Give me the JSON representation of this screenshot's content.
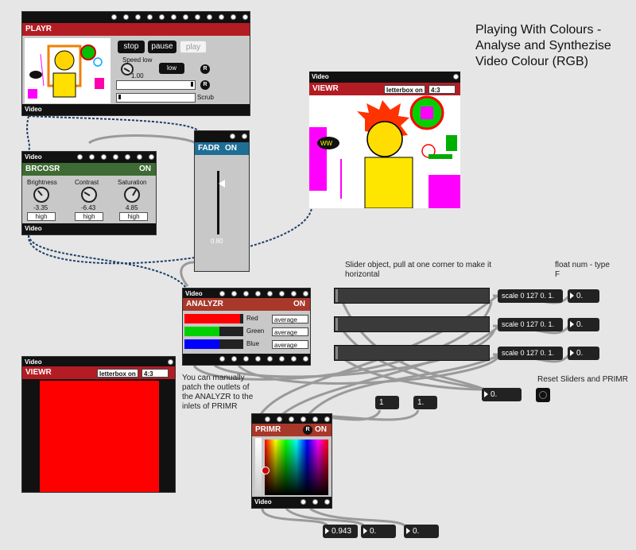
{
  "title_text": "Playing With Colours - Analyse and Synthezise Video Colour (RGB)",
  "video_port_label": "Video",
  "playr": {
    "title": "PLAYR",
    "stop_label": "stop",
    "pause_label": "pause",
    "play_label": "play",
    "speed_label": "Speed low",
    "speed_value": "1.00",
    "low_label": "low",
    "scrub_label": "Scrub",
    "reset_badge": "R"
  },
  "brcosr": {
    "title": "BRCOSR",
    "status": "ON",
    "brightness_label": "Brightness",
    "brightness_value": "-3.35",
    "contrast_label": "Contrast",
    "contrast_value": "-6.43",
    "saturation_label": "Saturation",
    "saturation_value": "4.85",
    "quality_label": "high"
  },
  "fadr": {
    "title": "FADR",
    "status": "ON",
    "value": "0.80",
    "level": 0.8
  },
  "viewr_top": {
    "title": "VIEWR",
    "letterbox": "letterbox on",
    "aspect": "4:3"
  },
  "analyzr": {
    "title": "ANALYZR",
    "status": "ON",
    "rows": [
      {
        "label": "Red",
        "mode": "average",
        "color": "#ff0000",
        "level": 0.95
      },
      {
        "label": "Green",
        "mode": "average",
        "color": "#00d000",
        "level": 0.6
      },
      {
        "label": "Blue",
        "mode": "average",
        "color": "#0000ff",
        "level": 0.6
      }
    ]
  },
  "viewr_bottom": {
    "title": "VIEWR",
    "letterbox": "letterbox on",
    "aspect": "4:3",
    "fill_color": "#ff0000"
  },
  "primr": {
    "title": "PRIMR",
    "status": "ON",
    "reset_badge": "R"
  },
  "notes": {
    "slider_note": "Slider object, pull at one corner to make it horizontal",
    "float_note": "float num - type F",
    "patch_note": "You can manually patch the outlets of the ANALYZR to the inlets of PRIMR",
    "reset_note": "Reset Sliders and PRIMR"
  },
  "scale_objects": [
    "scale 0 127 0. 1.",
    "scale 0 127 0. 1.",
    "scale 0 127 0. 1."
  ],
  "float_boxes": [
    "0.",
    "0.",
    "0."
  ],
  "msg_1": "1",
  "msg_1f": "1.",
  "reset_float": "0.",
  "bottom_floats": [
    "0.943",
    "0.",
    "0."
  ]
}
